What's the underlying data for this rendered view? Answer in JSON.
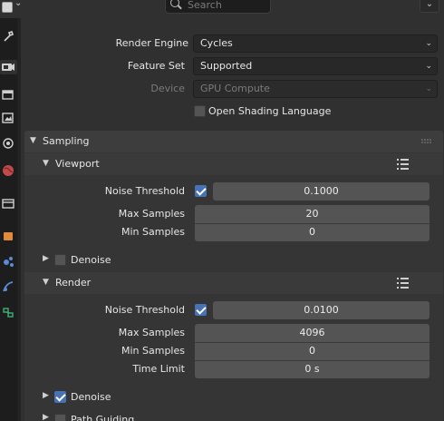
{
  "header": {
    "search_placeholder": "Search",
    "editor_type_icon": "properties-editor-icon",
    "options_icon": "chevron-down-icon"
  },
  "tabs": [
    {
      "icon": "tool-icon"
    },
    {
      "icon": "render-icon",
      "active": true
    },
    {
      "icon": "output-icon"
    },
    {
      "icon": "view-layer-icon"
    },
    {
      "icon": "scene-icon"
    },
    {
      "icon": "world-icon"
    },
    {
      "icon": "collection-icon"
    },
    {
      "icon": "object-icon"
    },
    {
      "icon": "modifier-icon"
    },
    {
      "icon": "particles-icon"
    },
    {
      "icon": "physics-icon"
    }
  ],
  "render": {
    "engine_label": "Render Engine",
    "engine_value": "Cycles",
    "feature_set_label": "Feature Set",
    "feature_set_value": "Supported",
    "device_label": "Device",
    "device_value": "GPU Compute",
    "osl_label": "Open Shading Language",
    "osl_checked": false
  },
  "sampling": {
    "title": "Sampling",
    "viewport": {
      "title": "Viewport",
      "noise_threshold_label": "Noise Threshold",
      "noise_threshold_enabled": true,
      "noise_threshold_value": "0.1000",
      "max_samples_label": "Max Samples",
      "max_samples_value": "20",
      "min_samples_label": "Min Samples",
      "min_samples_value": "0",
      "denoise_label": "Denoise",
      "denoise_checked": false
    },
    "render": {
      "title": "Render",
      "noise_threshold_label": "Noise Threshold",
      "noise_threshold_enabled": true,
      "noise_threshold_value": "0.0100",
      "max_samples_label": "Max Samples",
      "max_samples_value": "4096",
      "min_samples_label": "Min Samples",
      "min_samples_value": "0",
      "time_limit_label": "Time Limit",
      "time_limit_value": "0 s",
      "denoise_label": "Denoise",
      "denoise_checked": true
    },
    "path_guiding_label": "Path Guiding"
  },
  "colors": {
    "accent": "#4772b3",
    "background": "#303030",
    "field": "#545454"
  }
}
